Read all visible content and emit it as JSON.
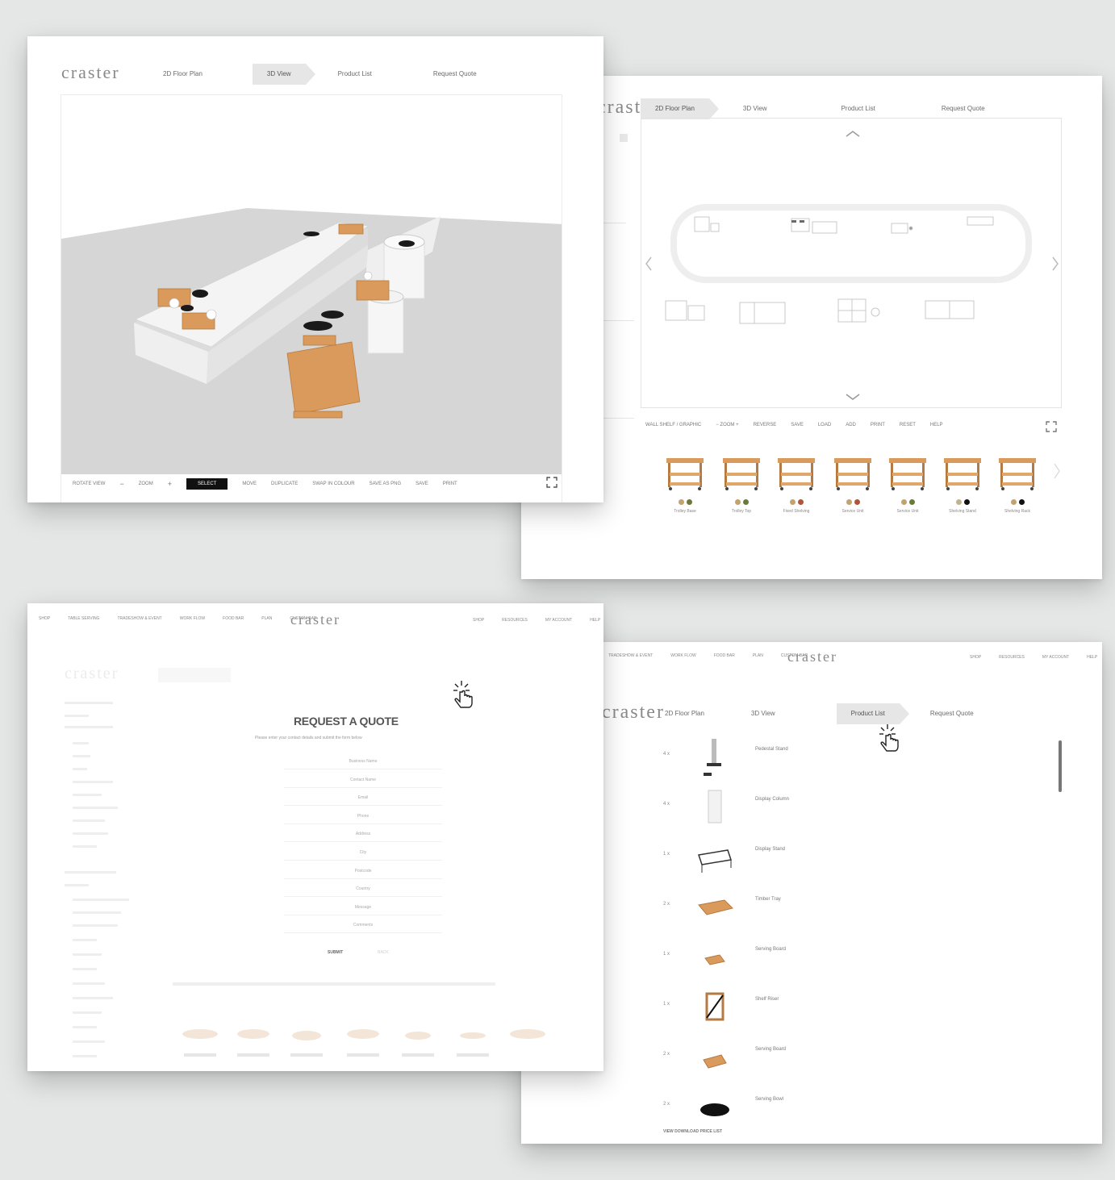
{
  "brand": "craster",
  "nav_tabs": [
    "2D Floor Plan",
    "3D View",
    "Product List",
    "Request Quote"
  ],
  "card1": {
    "active_tab": "3D View",
    "toolbar": [
      "ROTATE VIEW",
      "−",
      "ZOOM",
      "+",
      "SELECT",
      "MOVE",
      "DUPLICATE",
      "SWAP IN COLOUR",
      "SAVE AS PNG",
      "SAVE",
      "PRINT"
    ]
  },
  "card2": {
    "active_tab": "2D Floor Plan",
    "toolbar": [
      "WALL SHELF / GRAPHIC",
      "− ZOOM +",
      "REVERSE",
      "SAVE",
      "LOAD",
      "ADD",
      "PRINT",
      "RESET",
      "HELP"
    ],
    "products": [
      {
        "name": "Trolley Base"
      },
      {
        "name": "Trolley Top"
      },
      {
        "name": "Fixed Shelving"
      },
      {
        "name": "Service Unit"
      },
      {
        "name": "Service Unit"
      },
      {
        "name": "Shelving Stand"
      },
      {
        "name": "Shelving Rack"
      }
    ]
  },
  "card3": {
    "topnav_left": [
      "SHOP",
      "TABLE SERVING",
      "TRADESHOW & EVENT",
      "WORK FLOW",
      "FOOD BAR",
      "PLAN",
      "CUSTOM BAR"
    ],
    "topnav_right": [
      "SHOP",
      "RESOURCES",
      "MY ACCOUNT",
      "HELP"
    ],
    "title": "REQUEST A QUOTE",
    "subtitle": "Please enter your contact details and submit the form below",
    "fields": [
      "Business Name",
      "Contact Name",
      "Email",
      "Phone",
      "Address",
      "City",
      "Postcode",
      "Country",
      "Message",
      "Comments"
    ],
    "buttons": [
      "SUBMIT",
      "BACK"
    ]
  },
  "card4": {
    "active_tab": "Product List",
    "topnav_left": [
      "TRADESHOW & EVENT",
      "WORK FLOW",
      "FOOD BAR",
      "PLAN",
      "CUSTOM BAR"
    ],
    "topnav_right": [
      "SHOP",
      "RESOURCES",
      "MY ACCOUNT",
      "HELP"
    ],
    "items": [
      {
        "qty": "4 x",
        "name": "Pedestal Stand",
        "dims": ""
      },
      {
        "qty": "4 x",
        "name": "Display Column",
        "dims": ""
      },
      {
        "qty": "1 x",
        "name": "Display Stand",
        "dims": ""
      },
      {
        "qty": "2 x",
        "name": "Timber Tray",
        "dims": ""
      },
      {
        "qty": "1 x",
        "name": "Serving Board",
        "dims": ""
      },
      {
        "qty": "1 x",
        "name": "Shelf Riser",
        "dims": ""
      },
      {
        "qty": "2 x",
        "name": "Serving Board",
        "dims": ""
      },
      {
        "qty": "2 x",
        "name": "Serving Bowl",
        "dims": ""
      }
    ],
    "footer_link": "VIEW DOWNLOAD PRICE LIST"
  },
  "colors": {
    "accent_wood": "#d99a5b",
    "dark": "#111111",
    "bg": "#e4e7e6"
  }
}
